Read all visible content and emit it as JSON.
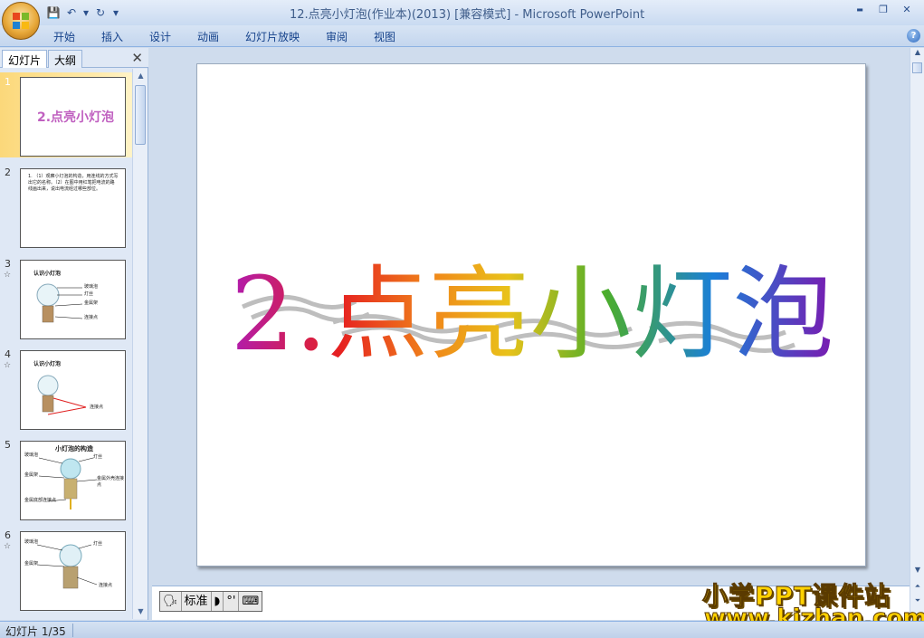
{
  "window": {
    "title": "12.点亮小灯泡(作业本)(2013) [兼容模式]",
    "separator": " - ",
    "app_name": "Microsoft PowerPoint",
    "minimize": "▬",
    "restore": "❐",
    "close": "✕"
  },
  "qat": {
    "save": "💾",
    "undo": "↶",
    "undo_drop": "▾",
    "redo": "↻",
    "customize": "▾"
  },
  "ribbon": {
    "tabs": [
      "开始",
      "插入",
      "设计",
      "动画",
      "幻灯片放映",
      "审阅",
      "视图"
    ],
    "help": "?"
  },
  "left_panel": {
    "tab_slides": "幻灯片",
    "tab_outline": "大纲",
    "close": "✕",
    "slides": [
      {
        "num": "1",
        "star": "",
        "title": "2.点亮小灯泡"
      },
      {
        "num": "2",
        "star": "",
        "text": "1. （1）观察小灯泡的构造，用连线的方式写出它的名称。（2）在图中用红笔把电流的路线画出来，说出电流经过哪些部位。"
      },
      {
        "num": "3",
        "star": "☆",
        "title": "认识小灯泡",
        "labels": [
          "玻璃泡",
          "灯丝",
          "金属架",
          "连接点"
        ]
      },
      {
        "num": "4",
        "star": "☆",
        "title": "认识小灯泡",
        "labels": [
          "连接点"
        ]
      },
      {
        "num": "5",
        "star": "",
        "title": "小灯泡的构造",
        "labels": [
          "玻璃泡",
          "灯丝",
          "金属架",
          "金属外壳连接点",
          "金属底部连接点"
        ]
      },
      {
        "num": "6",
        "star": "☆",
        "labels": [
          "玻璃泡",
          "灯丝",
          "金属架",
          "连接点"
        ]
      }
    ]
  },
  "slide": {
    "title": "2.点亮小灯泡",
    "title_colors": [
      "#b01cb0",
      "#e62020",
      "#f08a1a",
      "#e9c21a",
      "#4cae2a",
      "#1a7fd8",
      "#7a1ab0"
    ]
  },
  "ime": {
    "icon": "🗣",
    "mode": "标准",
    "moon": "◗",
    "punct": "°'",
    "keyboard": "⌨"
  },
  "watermark": {
    "line1": "小学PPT课件站",
    "line2": "www.kjzhan.com"
  },
  "status": {
    "slide_info": "幻灯片 1/35"
  },
  "colors": {
    "accent": "#15428b",
    "selected": "#fbd87a"
  }
}
